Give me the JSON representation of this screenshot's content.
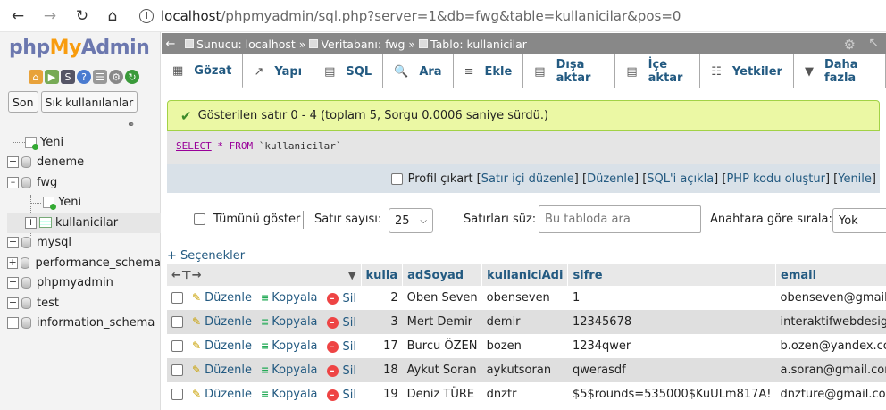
{
  "browser": {
    "url_host": "localhost",
    "url_path": "/phpmyadmin/sql.php?server=1&db=fwg&table=kullanicilar&pos=0"
  },
  "logo": {
    "php": "php",
    "my": "My",
    "admin": "Admin"
  },
  "quick_buttons": [
    "Son",
    "Sık kullanılanlar"
  ],
  "tree": {
    "new_label": "Yeni",
    "databases": [
      {
        "name": "deneme"
      },
      {
        "name": "fwg"
      },
      {
        "name": "mysql"
      },
      {
        "name": "performance_schema"
      },
      {
        "name": "phpmyadmin"
      },
      {
        "name": "test"
      },
      {
        "name": "information_schema"
      }
    ],
    "fwg_children": {
      "new_label": "Yeni",
      "table": "kullanicilar"
    }
  },
  "breadcrumb": {
    "server": "Sunucu: localhost",
    "database": "Veritabanı: fwg",
    "table": "Tablo: kullanicilar",
    "separator": "»"
  },
  "tabs": [
    {
      "label": "Gözat",
      "icon": "browse-icon"
    },
    {
      "label": "Yapı",
      "icon": "structure-icon"
    },
    {
      "label": "SQL",
      "icon": "sql-icon"
    },
    {
      "label": "Ara",
      "icon": "search-icon"
    },
    {
      "label": "Ekle",
      "icon": "insert-icon"
    },
    {
      "label": "Dışa aktar",
      "icon": "export-icon"
    },
    {
      "label": "İçe aktar",
      "icon": "import-icon"
    },
    {
      "label": "Yetkiler",
      "icon": "privileges-icon"
    },
    {
      "label": "Daha fazla",
      "icon": "chevron-down-icon"
    }
  ],
  "message": {
    "text": "Gösterilen satır 0 - 4 (toplam 5, Sorgu 0.0006 saniye sürdü.)"
  },
  "sql": {
    "select": "SELECT",
    "star": "*",
    "from": "FROM",
    "table": "`kullanicilar`"
  },
  "sql_actions": {
    "profile": "Profil çıkart",
    "inline_edit": "Satır içi düzenle",
    "edit": "Düzenle",
    "explain": "SQL'i açıkla",
    "php_code": "PHP kodu oluştur",
    "refresh": "Yenile"
  },
  "controls": {
    "show_all": "Tümünü göster",
    "rows_label": "Satır sayısı:",
    "rows_value": "25",
    "filter_label": "Satırları süz:",
    "filter_placeholder": "Bu tabloda ara",
    "sort_label": "Anahtara göre sırala:",
    "sort_value": "Yok"
  },
  "options_link": "+ Seçenekler",
  "table": {
    "columns": [
      "kulla",
      "adSoyad",
      "kullaniciAdi",
      "sifre",
      "email"
    ],
    "action_labels": {
      "edit": "Düzenle",
      "copy": "Kopyala",
      "delete": "Sil"
    },
    "rows": [
      {
        "id": "2",
        "adSoyad": "Oben Seven",
        "kullaniciAdi": "obenseven",
        "sifre": "1",
        "email": "obenseven@gmail.c"
      },
      {
        "id": "3",
        "adSoyad": "Mert Demir",
        "kullaniciAdi": "demir",
        "sifre": "12345678",
        "email": "interaktifwebdesign@"
      },
      {
        "id": "17",
        "adSoyad": "Burcu ÖZEN",
        "kullaniciAdi": "bozen",
        "sifre": "1234qwer",
        "email": "b.ozen@yandex.com"
      },
      {
        "id": "18",
        "adSoyad": "Aykut Soran",
        "kullaniciAdi": "aykutsoran",
        "sifre": "qwerasdf",
        "email": "a.soran@gmail.com"
      },
      {
        "id": "19",
        "adSoyad": "Deniz TÜRE",
        "kullaniciAdi": "dnztr",
        "sifre": "$5$rounds=535000$KuULm817A!",
        "email": "dnzture@gmail.com"
      }
    ]
  }
}
